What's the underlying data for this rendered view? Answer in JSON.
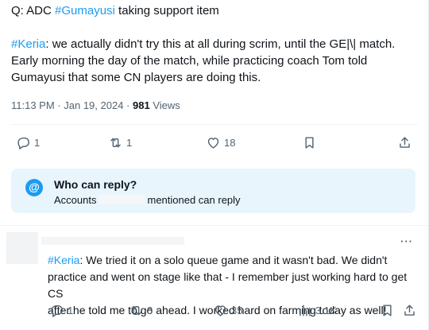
{
  "tweet": {
    "line1_prefix": "Q: ADC ",
    "line1_hashtag": "#Gumayusi",
    "line1_suffix": " taking support item",
    "para_hashtag": "#Keria",
    "para_line1": ": we actually didn't try this at all during scrim, until the GE|\\| match.",
    "para_line2": "Early morning the day of the match, while practicing coach Tom told",
    "para_line3": "Gumayusi that some CN players are doing this."
  },
  "meta": {
    "time": "11:13 PM",
    "sep": " · ",
    "date": "Jan 19, 2024",
    "views_count": "981",
    "views_label": " Views"
  },
  "actions": {
    "replies": "1",
    "reposts": "1",
    "likes": "18"
  },
  "who_can_reply": {
    "icon": "@",
    "title": "Who can reply?",
    "sub_prefix": "Accounts",
    "sub_suffix": "mentioned can reply"
  },
  "reply": {
    "more": "···",
    "hashtag": "#Keria",
    "line1": ": We tried it on a solo queue game and it wasn't bad. We didn't",
    "line2": "practice and went on stage like that - I remember just working hard to get CS",
    "line3": "after he told me to go ahead. I worked hard on farming today as well!",
    "replies": "1",
    "reposts": "8",
    "likes": "35",
    "views": "3.1K"
  },
  "colors": {
    "accent": "#1d9bf0",
    "secondary_text": "#536471",
    "reply_box_bg": "#e8f5fd"
  },
  "icons": [
    "reply-icon",
    "repost-icon",
    "like-icon",
    "bookmark-icon",
    "share-icon",
    "views-icon",
    "at-icon",
    "more-icon"
  ]
}
